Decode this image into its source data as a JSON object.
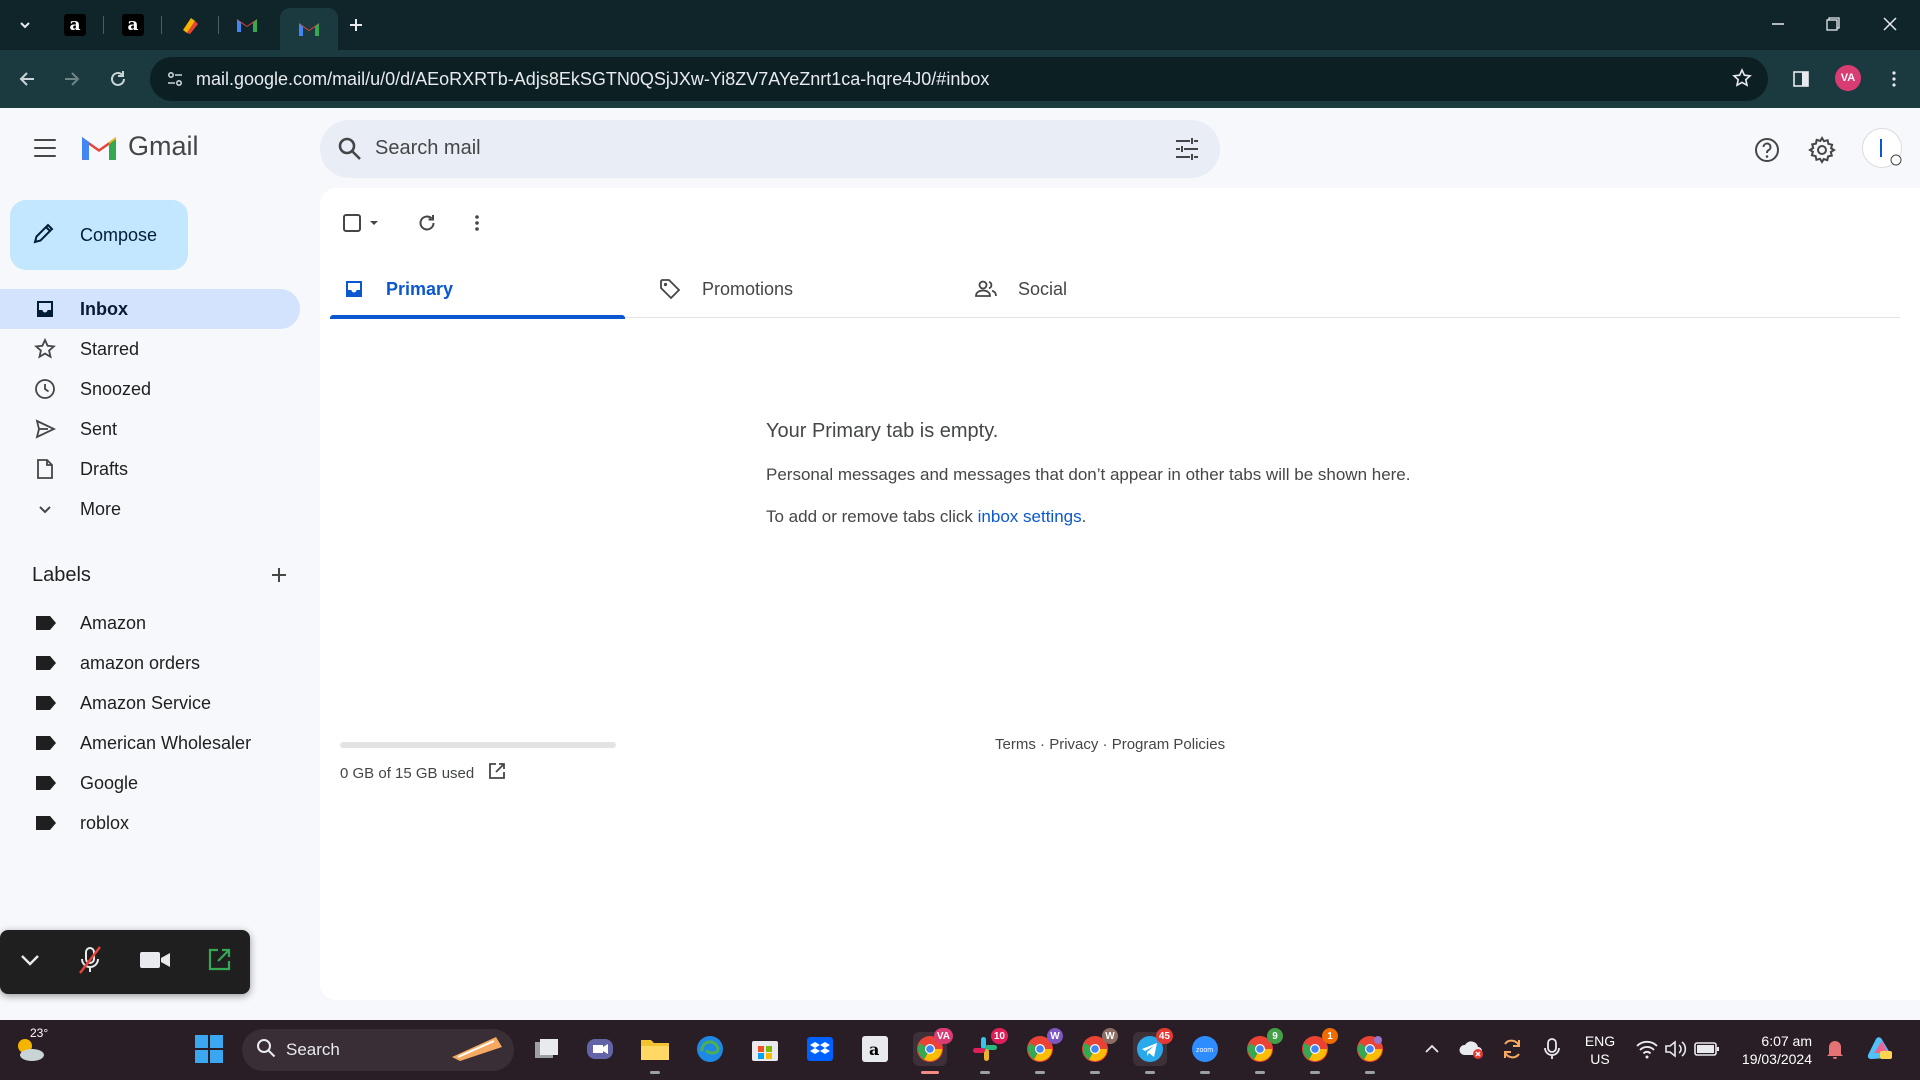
{
  "browser": {
    "url": "mail.google.com/mail/u/0/d/AEoRXRTb-Adjs8EkSGTN0QSjJXw-Yi8ZV7AYeZnrt1ca-hqre4J0/#inbox",
    "profile_initials": "VA"
  },
  "gmail": {
    "brand": "Gmail",
    "search_placeholder": "Search mail",
    "compose_label": "Compose",
    "nav": [
      {
        "label": "Inbox",
        "icon": "inbox-icon",
        "active": true
      },
      {
        "label": "Starred",
        "icon": "star-icon"
      },
      {
        "label": "Snoozed",
        "icon": "clock-icon"
      },
      {
        "label": "Sent",
        "icon": "send-icon"
      },
      {
        "label": "Drafts",
        "icon": "draft-icon"
      },
      {
        "label": "More",
        "icon": "chevron-down-icon"
      }
    ],
    "labels_heading": "Labels",
    "labels": [
      "Amazon",
      "amazon orders",
      "Amazon Service",
      "American Wholesaler",
      "Google",
      "roblox"
    ],
    "tabs": [
      {
        "label": "Primary",
        "icon": "inbox-tab-icon",
        "active": true
      },
      {
        "label": "Promotions",
        "icon": "tag-icon"
      },
      {
        "label": "Social",
        "icon": "people-icon"
      }
    ],
    "empty": {
      "title": "Your Primary tab is empty.",
      "line1": "Personal messages and messages that don’t appear in other tabs will be shown here.",
      "line2_prefix": "To add or remove tabs click ",
      "line2_link": "inbox settings",
      "line2_suffix": "."
    },
    "storage": {
      "text": "0 GB of 15 GB used",
      "used_fraction": 0
    },
    "footer": {
      "terms": "Terms",
      "privacy": "Privacy",
      "policies": "Program Policies",
      "sep": " · "
    }
  },
  "taskbar": {
    "weather_temp": "23°",
    "search_label": "Search",
    "badges": {
      "chrome_va": "VA",
      "slack": "10",
      "chrome_w1": "W",
      "chrome_w2": "W",
      "telegram": "45",
      "chrome_9": "9",
      "chrome_1": "1"
    },
    "lang": "ENG",
    "region": "US",
    "time": "6:07 am",
    "date": "19/03/2024"
  },
  "colors": {
    "accent": "#0b57d0",
    "compose_bg": "#c2e7ff",
    "active_nav": "#d3e3fd"
  }
}
